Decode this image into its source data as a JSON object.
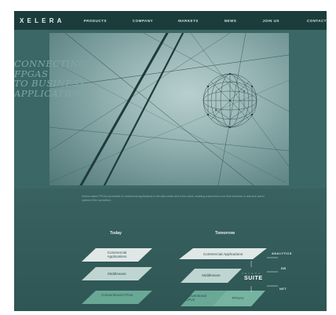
{
  "nav": {
    "logo": "XELERA",
    "links": [
      "PRODUCTS",
      "COMPANY",
      "MARKETS",
      "NEWS",
      "JOIN US",
      "CONTACT"
    ]
  },
  "hero": {
    "title_lines": [
      "CONNECTING FPGAS",
      "TO BUSINESS",
      "APPLICATIONS"
    ]
  },
  "description": "Xelera makes FPGAs accessible to commercial applications in the data center and in the cloud, enabling customers to run their business in real-time and to optimize their operations.",
  "diagram": {
    "today": {
      "heading": "Today",
      "layers": [
        "Commercial Applications",
        "Middleware",
        "Conventional CPUs"
      ]
    },
    "tomorrow": {
      "heading": "Tomorrow",
      "layers": {
        "top": "Commercial Applications",
        "middle": "Middleware",
        "bottom_left": "Conventional CPUs",
        "bottom_right": "FPGAs"
      },
      "suite_small": "XELERA",
      "suite_big": "SUITE",
      "tags": [
        "ANALYTICS",
        "DB",
        "NET"
      ]
    }
  },
  "colors": {
    "background": "#3b6664",
    "nav_bg": "#1a3d3b",
    "title": "#7ea8a4",
    "layer_light": "#dfe7e6",
    "layer_mid": "#bdd3d0",
    "layer_green": "#6ba897"
  }
}
